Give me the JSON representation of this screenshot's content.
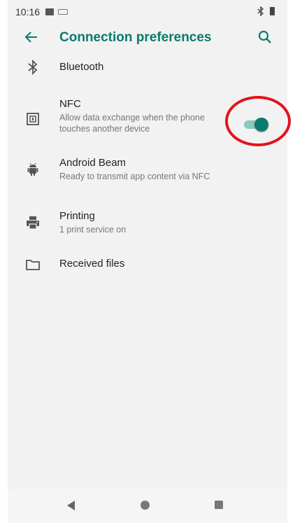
{
  "status_bar": {
    "time": "10:16"
  },
  "app_bar": {
    "title": "Connection preferences"
  },
  "items": [
    {
      "label": "Bluetooth",
      "icon": "bluetooth-icon"
    },
    {
      "label": "NFC",
      "subtitle": "Allow data exchange when the phone touches another device",
      "icon": "nfc-icon",
      "toggle_on": true
    },
    {
      "label": "Android Beam",
      "subtitle": "Ready to transmit app content via NFC",
      "icon": "android-icon"
    },
    {
      "label": "Printing",
      "subtitle": "1 print service on",
      "icon": "printer-icon"
    },
    {
      "label": "Received files",
      "icon": "folder-icon"
    }
  ],
  "colors": {
    "accent": "#0b7a6b",
    "toggle_track": "#8cc8bd",
    "highlight": "#e3131b",
    "background": "#f2f2f2"
  }
}
